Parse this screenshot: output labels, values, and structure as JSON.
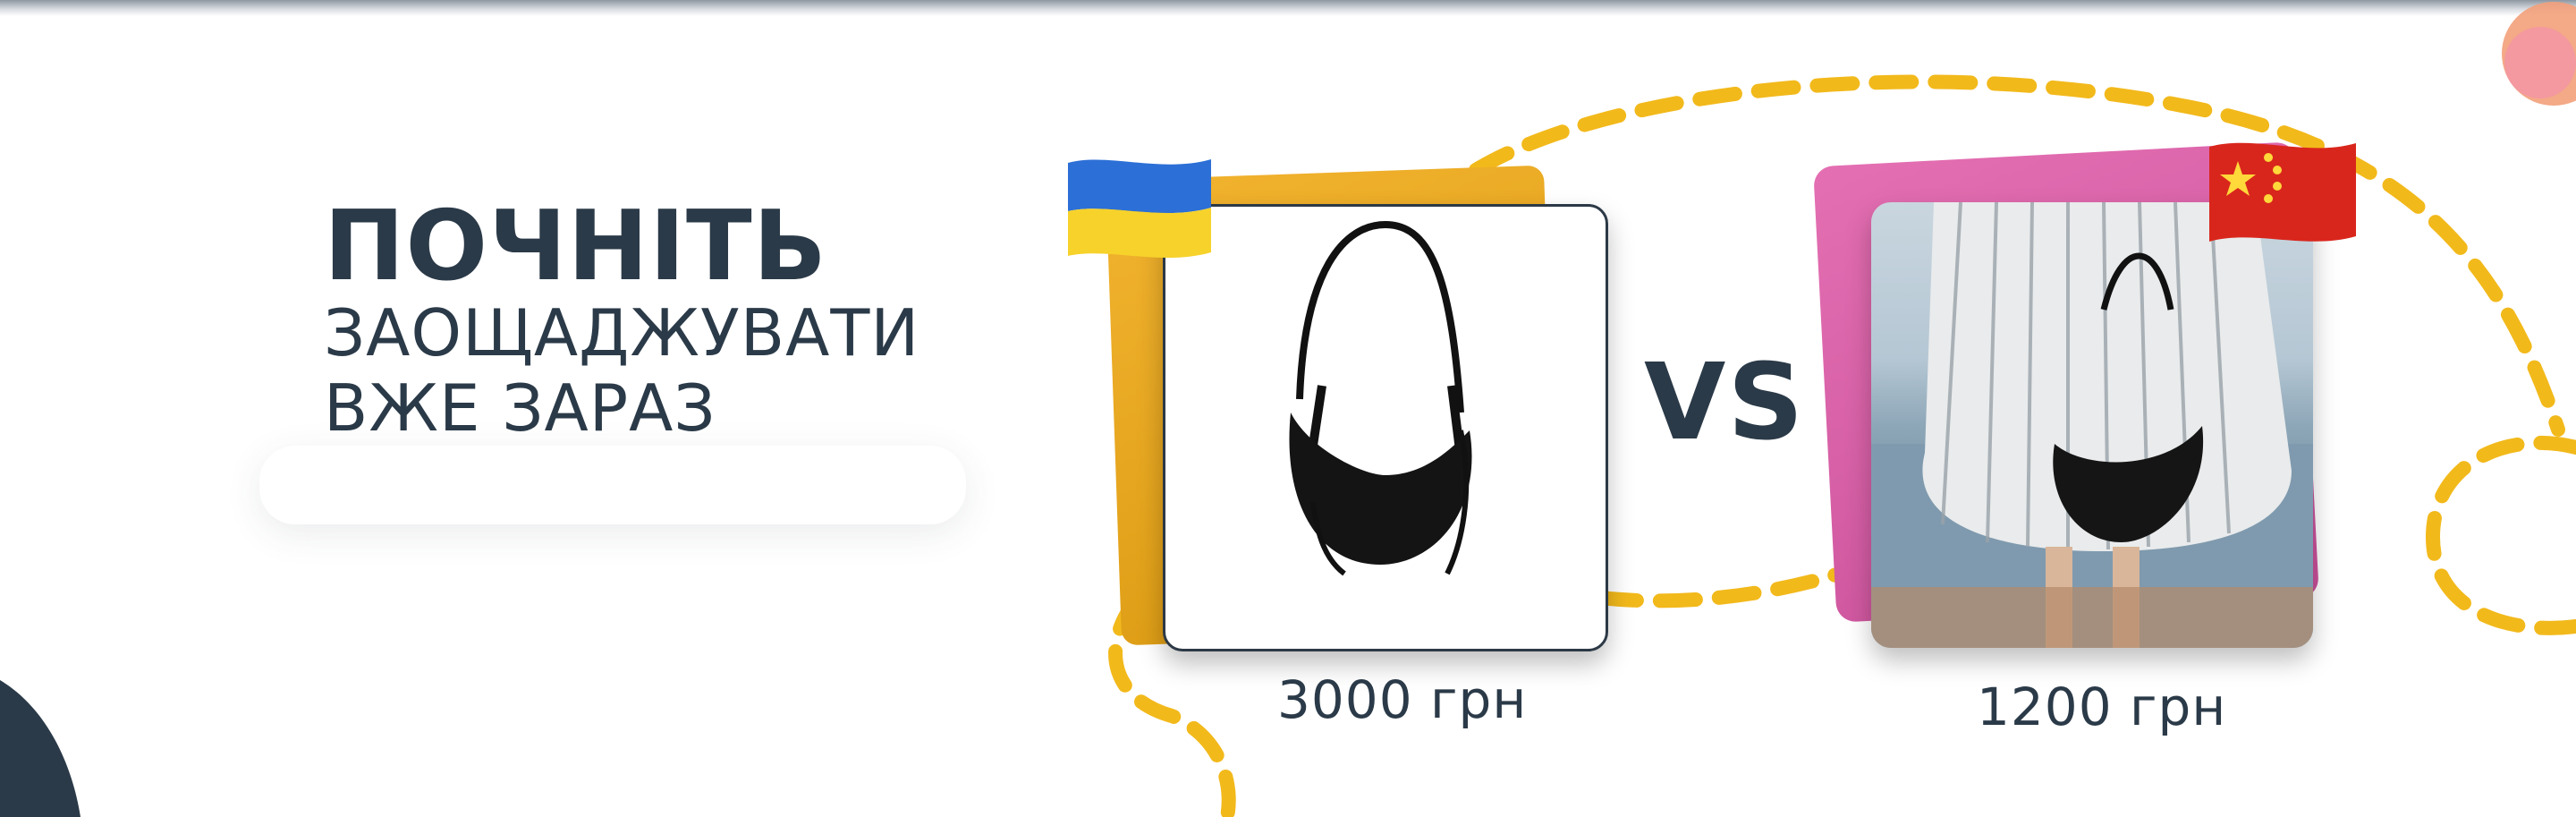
{
  "headline": {
    "line1": "ПОЧНІТЬ",
    "line2": "ЗАОЩАДЖУВАТИ",
    "line3": "ВЖЕ ЗАРАЗ"
  },
  "comparison": {
    "vs_label": "VS",
    "left": {
      "price": "3000 грн",
      "flag": "ukraine-flag-icon"
    },
    "right": {
      "price": "1200 грн",
      "flag": "china-flag-icon"
    }
  },
  "colors": {
    "text": "#2b3a48",
    "dash": "#f2b91b",
    "card_left_back": "#e4a51f",
    "card_right_back": "#d95ba5"
  }
}
